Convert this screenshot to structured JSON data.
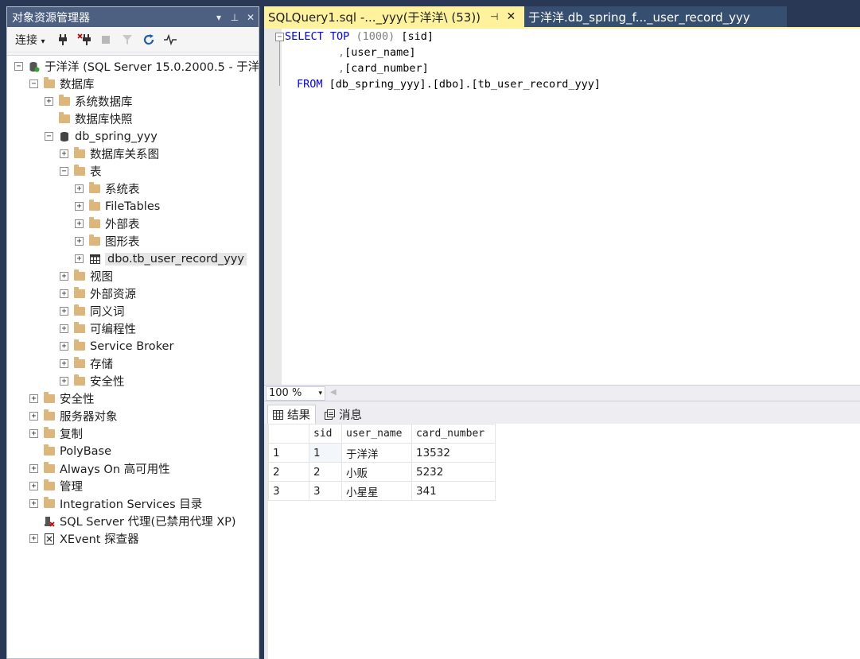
{
  "object_explorer": {
    "title": "对象资源管理器",
    "title_buttons": [
      "▾",
      "⊥",
      "✕"
    ],
    "toolbar": {
      "connect_label": "连接",
      "dropdown": "▾"
    },
    "tree": {
      "server": "于洋洋 (SQL Server 15.0.2000.5 - 于洋",
      "databases": "数据库",
      "system_databases": "系统数据库",
      "snapshots": "数据库快照",
      "db_name": "db_spring_yyy",
      "diagrams": "数据库关系图",
      "tables": "表",
      "system_tables": "系统表",
      "file_tables": "FileTables",
      "external_tables": "外部表",
      "graph_tables": "图形表",
      "user_table": "dbo.tb_user_record_yyy",
      "views": "视图",
      "external_resources": "外部资源",
      "synonyms": "同义词",
      "programmability": "可编程性",
      "service_broker": "Service Broker",
      "storage": "存储",
      "db_security": "安全性",
      "security": "安全性",
      "server_objects": "服务器对象",
      "replication": "复制",
      "polybase": "PolyBase",
      "always_on": "Always On 高可用性",
      "management": "管理",
      "integration_services": "Integration Services 目录",
      "agent": "SQL Server 代理(已禁用代理 XP)",
      "xevent": "XEvent 探查器"
    }
  },
  "tabs": {
    "query_tab": "SQLQuery1.sql -..._yyy(于洋洋\\    (53))",
    "pin": "⊣",
    "close": "✕",
    "table_tab": "于洋洋.db_spring_f..._user_record_yyy"
  },
  "editor": {
    "line1": {
      "kw1": "SELECT",
      "kw2": "TOP",
      "num": "(1000)",
      "col": "[sid]"
    },
    "line2": {
      "prefix": ",",
      "col": "[user_name]"
    },
    "line3": {
      "prefix": ",",
      "col": "[card_number]"
    },
    "line4": {
      "kw": "FROM",
      "obj": "[db_spring_yyy].[dbo].[tb_user_record_yyy]"
    }
  },
  "zoom": {
    "value": "100 %",
    "dropdown": "▾"
  },
  "results": {
    "tab_results": "结果",
    "tab_messages": "消息",
    "columns": [
      "sid",
      "user_name",
      "card_number"
    ],
    "rows": [
      {
        "rn": "1",
        "sid": "1",
        "user_name": "于洋洋",
        "card_number": "13532"
      },
      {
        "rn": "2",
        "sid": "2",
        "user_name": "小贩",
        "card_number": "5232"
      },
      {
        "rn": "3",
        "sid": "3",
        "user_name": "小星星",
        "card_number": "341"
      }
    ]
  },
  "colors": {
    "accent_tab": "#fff29d",
    "title_bar": "#4d6082",
    "keyword": "#0000ff",
    "folder": "#dcb67a"
  }
}
